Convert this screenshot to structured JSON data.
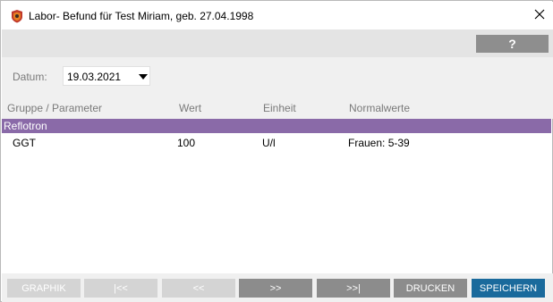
{
  "window": {
    "title": "Labor- Befund für Test Miriam, geb. 27.04.1998"
  },
  "help": {
    "label": "?"
  },
  "filter": {
    "date_label": "Datum:",
    "date_value": "19.03.2021"
  },
  "table": {
    "columns": [
      "Gruppe / Parameter",
      "Wert",
      "Einheit",
      "Normalwerte"
    ],
    "groups": [
      {
        "name": "Reflotron",
        "rows": [
          {
            "parameter": "GGT",
            "wert": "100",
            "einheit": "U/l",
            "normalwerte": "Frauen: 5-39"
          }
        ]
      }
    ]
  },
  "buttons": {
    "graphik": "GRAPHIK",
    "first": "|<<",
    "prev": "<<",
    "next": ">>",
    "last": ">>|",
    "drucken": "DRUCKEN",
    "speichern": "SPEICHERN"
  },
  "colors": {
    "group_header": "#8a6aa8",
    "primary_button": "#1a6a9c",
    "enabled_button": "#8c8c8c",
    "disabled_button": "#d4d4d4"
  }
}
